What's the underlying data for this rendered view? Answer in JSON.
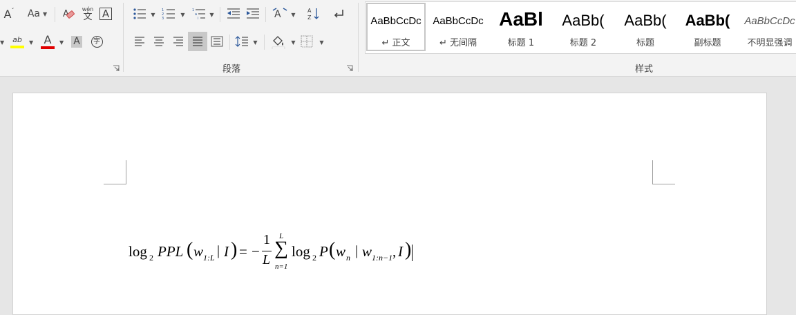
{
  "ribbon": {
    "paragraph_group_label": "段落",
    "styles_group_label": "样式",
    "font": {
      "shrink_font_glyph": "A",
      "change_case_glyph": "Aa",
      "phonetic_guide_top": "wén",
      "phonetic_guide_bottom": "文",
      "char_border_glyph": "A",
      "highlight_glyph": "ab",
      "font_color_glyph": "A",
      "char_shading_glyph": "A",
      "enclose_char_glyph": "字",
      "highlight_color": "#ffff00",
      "font_color": "#e00000"
    },
    "styles": [
      {
        "preview": "AaBbCcDc",
        "name": "↵ 正文",
        "selected": true
      },
      {
        "preview": "AaBbCcDc",
        "name": "↵ 无间隔",
        "selected": false
      },
      {
        "preview": "AaBl",
        "name": "标题 1",
        "selected": false
      },
      {
        "preview": "AaBb(",
        "name": "标题 2",
        "selected": false
      },
      {
        "preview": "AaBb(",
        "name": "标题",
        "selected": false
      },
      {
        "preview": "AaBb(",
        "name": "副标题",
        "selected": false
      },
      {
        "preview": "AaBbCcDc",
        "name": "不明显强调",
        "selected": false
      }
    ]
  },
  "document": {
    "equation": {
      "lhs_log": "log",
      "lhs_base": "2",
      "lhs_func": "PPL",
      "lhs_w": "w",
      "lhs_w_sub": "1:L",
      "lhs_bar": "|",
      "lhs_I": "I",
      "equals": "=",
      "minus": "−",
      "frac_num": "1",
      "frac_den": "L",
      "sum_symbol": "∑",
      "sum_upper": "L",
      "sum_lower": "n=1",
      "rhs_log": "log",
      "rhs_base": "2",
      "rhs_func": "P",
      "rhs_wn": "w",
      "rhs_wn_sub": "n",
      "rhs_bar": "|",
      "rhs_w": "w",
      "rhs_w_sub": "1:n−1",
      "rhs_comma": ",",
      "rhs_I": "I"
    }
  }
}
